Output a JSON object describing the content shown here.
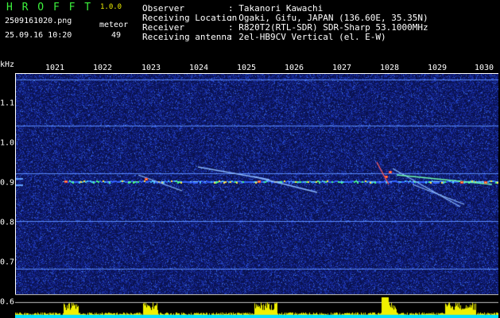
{
  "header": {
    "app_name": "H R O F F T",
    "version": "1.0.0",
    "filename": "2509161020.png",
    "timestamp": "25.09.16 10:20",
    "meteor_label": "meteor",
    "meteor_count": "49"
  },
  "station": {
    "labels": [
      "Observer",
      "Receiving Location",
      "Receiver",
      "Receiving antenna"
    ],
    "values": [
      ": Takanori Kawachi",
      ": Ogaki, Gifu, JAPAN (136.60E, 35.35N)",
      ": R820T2(RTL-SDR) SDR-Sharp 53.1000MHz",
      ": 2el-HB9CV Vertical (el. E-W)"
    ]
  },
  "spectrogram": {
    "y_unit": "kHz",
    "x_ticks": [
      "1021",
      "1022",
      "1023",
      "1024",
      "1025",
      "1026",
      "1027",
      "1028",
      "1029",
      "1030"
    ],
    "y_ticks": [
      "1.1",
      "1.0",
      "0.9",
      "0.8",
      "0.7",
      "0.6"
    ]
  },
  "colors": {
    "background": "#000000",
    "noise": "#1a2a9c",
    "header_green": "#3cf23c",
    "activity_yellow": "#f0f000",
    "activity_cyan": "#00e0ff"
  }
}
